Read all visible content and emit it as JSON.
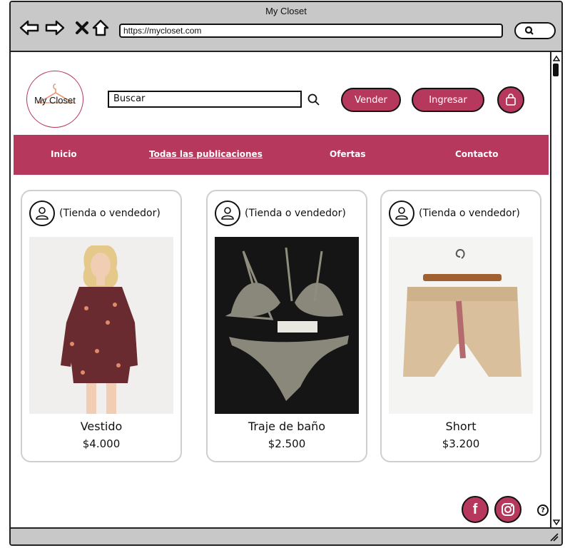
{
  "window": {
    "title": "My Closet",
    "url": "https://mycloset.com"
  },
  "brand": {
    "logo_text": "My Closet",
    "accent": "#b6385d"
  },
  "header": {
    "search_placeholder": "Buscar",
    "sell_label": "Vender",
    "login_label": "Ingresar"
  },
  "nav": {
    "items": [
      {
        "label": "Inicio"
      },
      {
        "label": "Todas las publicaciones",
        "active": true
      },
      {
        "label": "Ofertas"
      },
      {
        "label": "Contacto"
      }
    ]
  },
  "products": [
    {
      "seller": "(Tienda o vendedor)",
      "name": "Vestido",
      "price": "$4.000"
    },
    {
      "seller": "(Tienda o vendedor)",
      "name": "Traje de baño",
      "price": "$2.500"
    },
    {
      "seller": "(Tienda o vendedor)",
      "name": "Short",
      "price": "$3.200"
    }
  ],
  "footer_icons": [
    "facebook-icon",
    "instagram-icon",
    "help-icon"
  ],
  "help_glyph": "?"
}
